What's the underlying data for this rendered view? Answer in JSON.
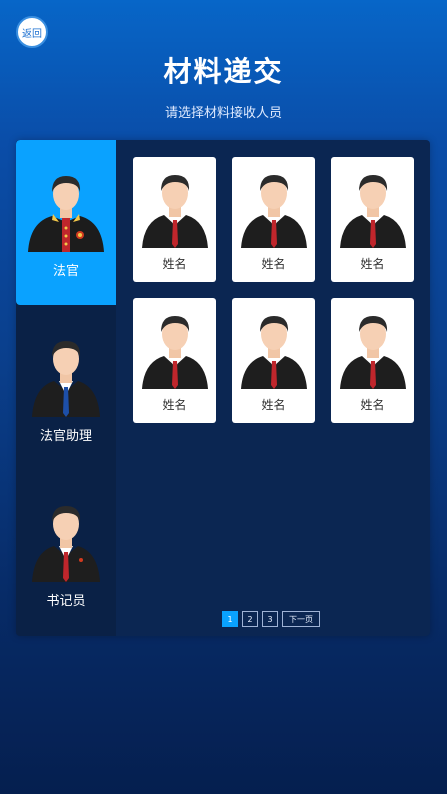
{
  "header": {
    "back_label": "返回",
    "title": "材料递交",
    "subtitle": "请选择材料接收人员"
  },
  "sidebar": {
    "items": [
      {
        "label": "法官",
        "icon": "judge-avatar-icon",
        "active": true
      },
      {
        "label": "法官助理",
        "icon": "assistant-avatar-icon",
        "active": false
      },
      {
        "label": "书记员",
        "icon": "clerk-avatar-icon",
        "active": false
      }
    ]
  },
  "cards": [
    {
      "name": "姓名"
    },
    {
      "name": "姓名"
    },
    {
      "name": "姓名"
    },
    {
      "name": "姓名"
    },
    {
      "name": "姓名"
    },
    {
      "name": "姓名"
    }
  ],
  "pagination": {
    "pages": [
      "1",
      "2",
      "3"
    ],
    "current": "1",
    "next_label": "下一页"
  },
  "colors": {
    "accent": "#0aa2ff",
    "panel": "#0b2652"
  }
}
